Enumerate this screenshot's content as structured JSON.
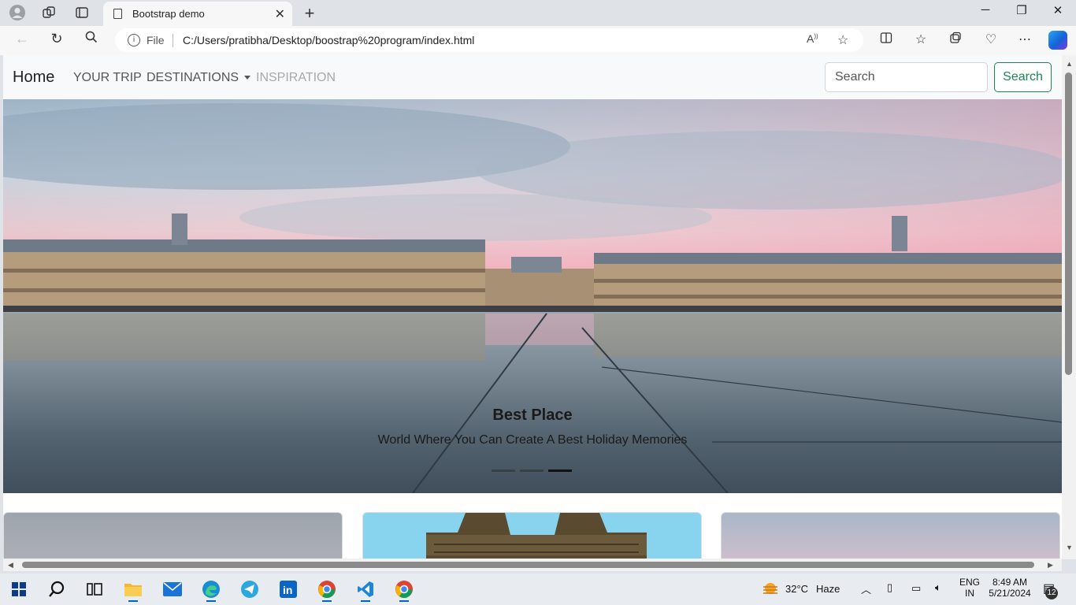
{
  "browser": {
    "tab_title": "Bootstrap demo",
    "address_prefix": "File",
    "url": "C:/Users/pratibha/Desktop/boostrap%20program/index.html"
  },
  "navbar": {
    "brand": "Home",
    "links": [
      {
        "label": "YOUR TRIP"
      },
      {
        "label": "DESTINATIONS"
      },
      {
        "label": "INSPIRATION"
      }
    ],
    "search_placeholder": "Search",
    "search_button": "Search"
  },
  "carousel": {
    "caption_title": "Best Place",
    "caption_text": "World Where You Can Create A Best Holiday Memories",
    "slide_count": 3,
    "active_index": 2
  },
  "taskbar": {
    "temperature": "32°C",
    "weather": "Haze",
    "lang_line1": "ENG",
    "lang_line2": "IN",
    "time": "8:49 AM",
    "date": "5/21/2024",
    "notification_count": "12"
  },
  "colors": {
    "accent_green": "#198754",
    "navbar_bg": "#f8f9fa",
    "windows_blue": "#0067c0"
  }
}
